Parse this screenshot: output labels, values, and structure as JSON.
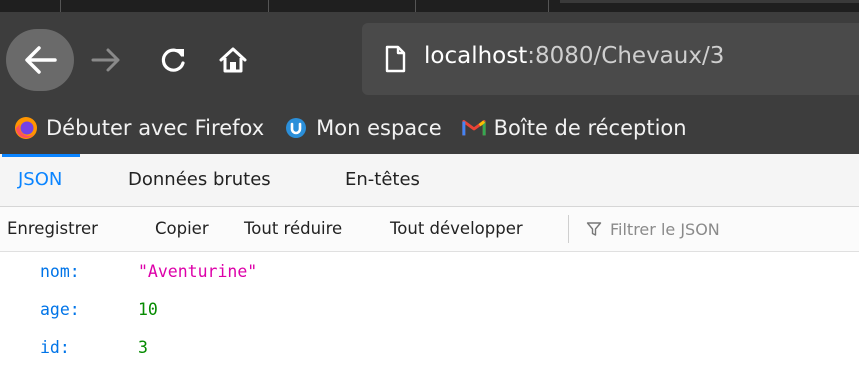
{
  "browser": {
    "url_host": "localhost",
    "url_rest": ":8080/Chevaux/3",
    "bookmarks": [
      {
        "label": "Débuter avec Firefox",
        "icon": "firefox-icon"
      },
      {
        "label": "Mon espace",
        "icon": "ent-icon"
      },
      {
        "label": "Boîte de réception",
        "icon": "gmail-icon"
      }
    ]
  },
  "viewer": {
    "tabs": [
      "JSON",
      "Données brutes",
      "En-têtes"
    ],
    "active_tab": "JSON",
    "toolbar": {
      "save": "Enregistrer",
      "copy": "Copier",
      "collapse_all": "Tout réduire",
      "expand_all": "Tout développer",
      "filter_placeholder": "Filtrer le JSON"
    },
    "rows": [
      {
        "key": "nom:",
        "value": "\"Aventurine\"",
        "type": "string"
      },
      {
        "key": "age:",
        "value": "10",
        "type": "number"
      },
      {
        "key": "id:",
        "value": "3",
        "type": "number"
      }
    ]
  },
  "colors": {
    "accent": "#0a84ff",
    "json_key": "#0074e8",
    "json_string": "#dd00a9",
    "json_number": "#058b00"
  }
}
